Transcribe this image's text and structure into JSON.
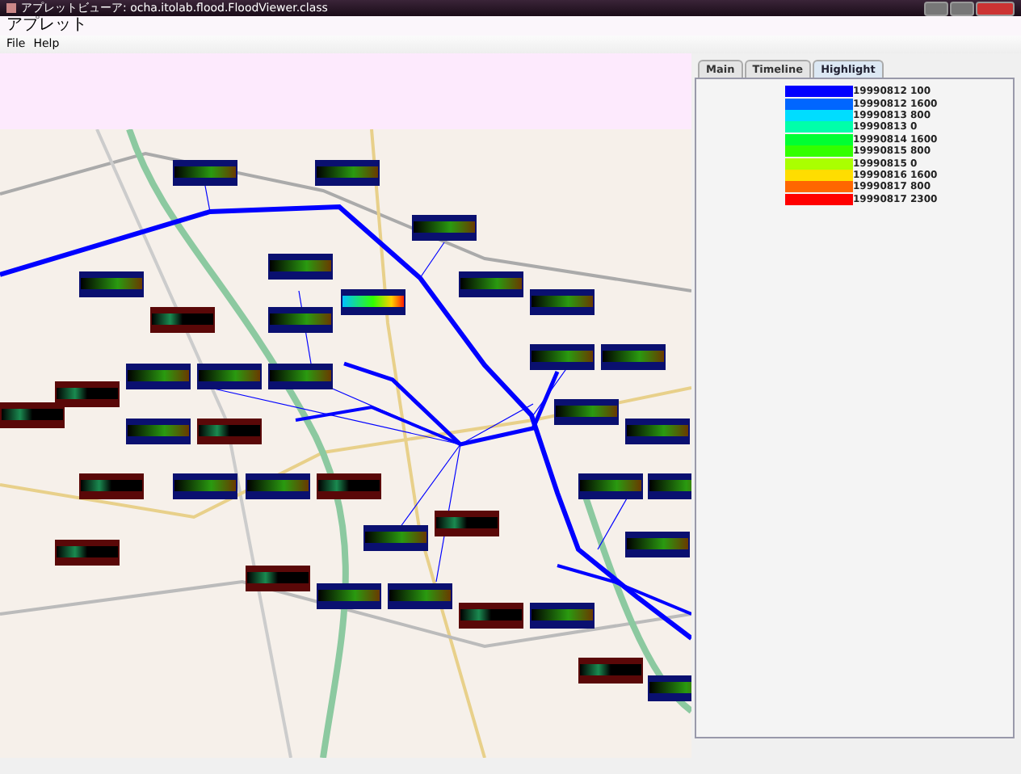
{
  "window": {
    "title": "アプレットビューア: ocha.itolab.flood.FloodViewer.class"
  },
  "applet_menu": {
    "label": "アプレット"
  },
  "menubar": {
    "items": [
      "File",
      "Help"
    ]
  },
  "tabs": [
    {
      "label": "Main",
      "selected": false
    },
    {
      "label": "Timeline",
      "selected": false
    },
    {
      "label": "Highlight",
      "selected": true
    }
  ],
  "legend": [
    {
      "label": "19990812 100",
      "color": "#0000ff"
    },
    {
      "label": "19990812 1600",
      "color": "#0066ff"
    },
    {
      "label": "19990813 800",
      "color": "#00ddff"
    },
    {
      "label": "19990813 0",
      "color": "#00ffaa"
    },
    {
      "label": "19990814 1600",
      "color": "#00ff33"
    },
    {
      "label": "19990815 800",
      "color": "#33ff00"
    },
    {
      "label": "19990815 0",
      "color": "#aaff00"
    },
    {
      "label": "19990816 1600",
      "color": "#ffdd00"
    },
    {
      "label": "19990817 800",
      "color": "#ff6600"
    },
    {
      "label": "19990817 2300",
      "color": "#ff0000"
    }
  ]
}
